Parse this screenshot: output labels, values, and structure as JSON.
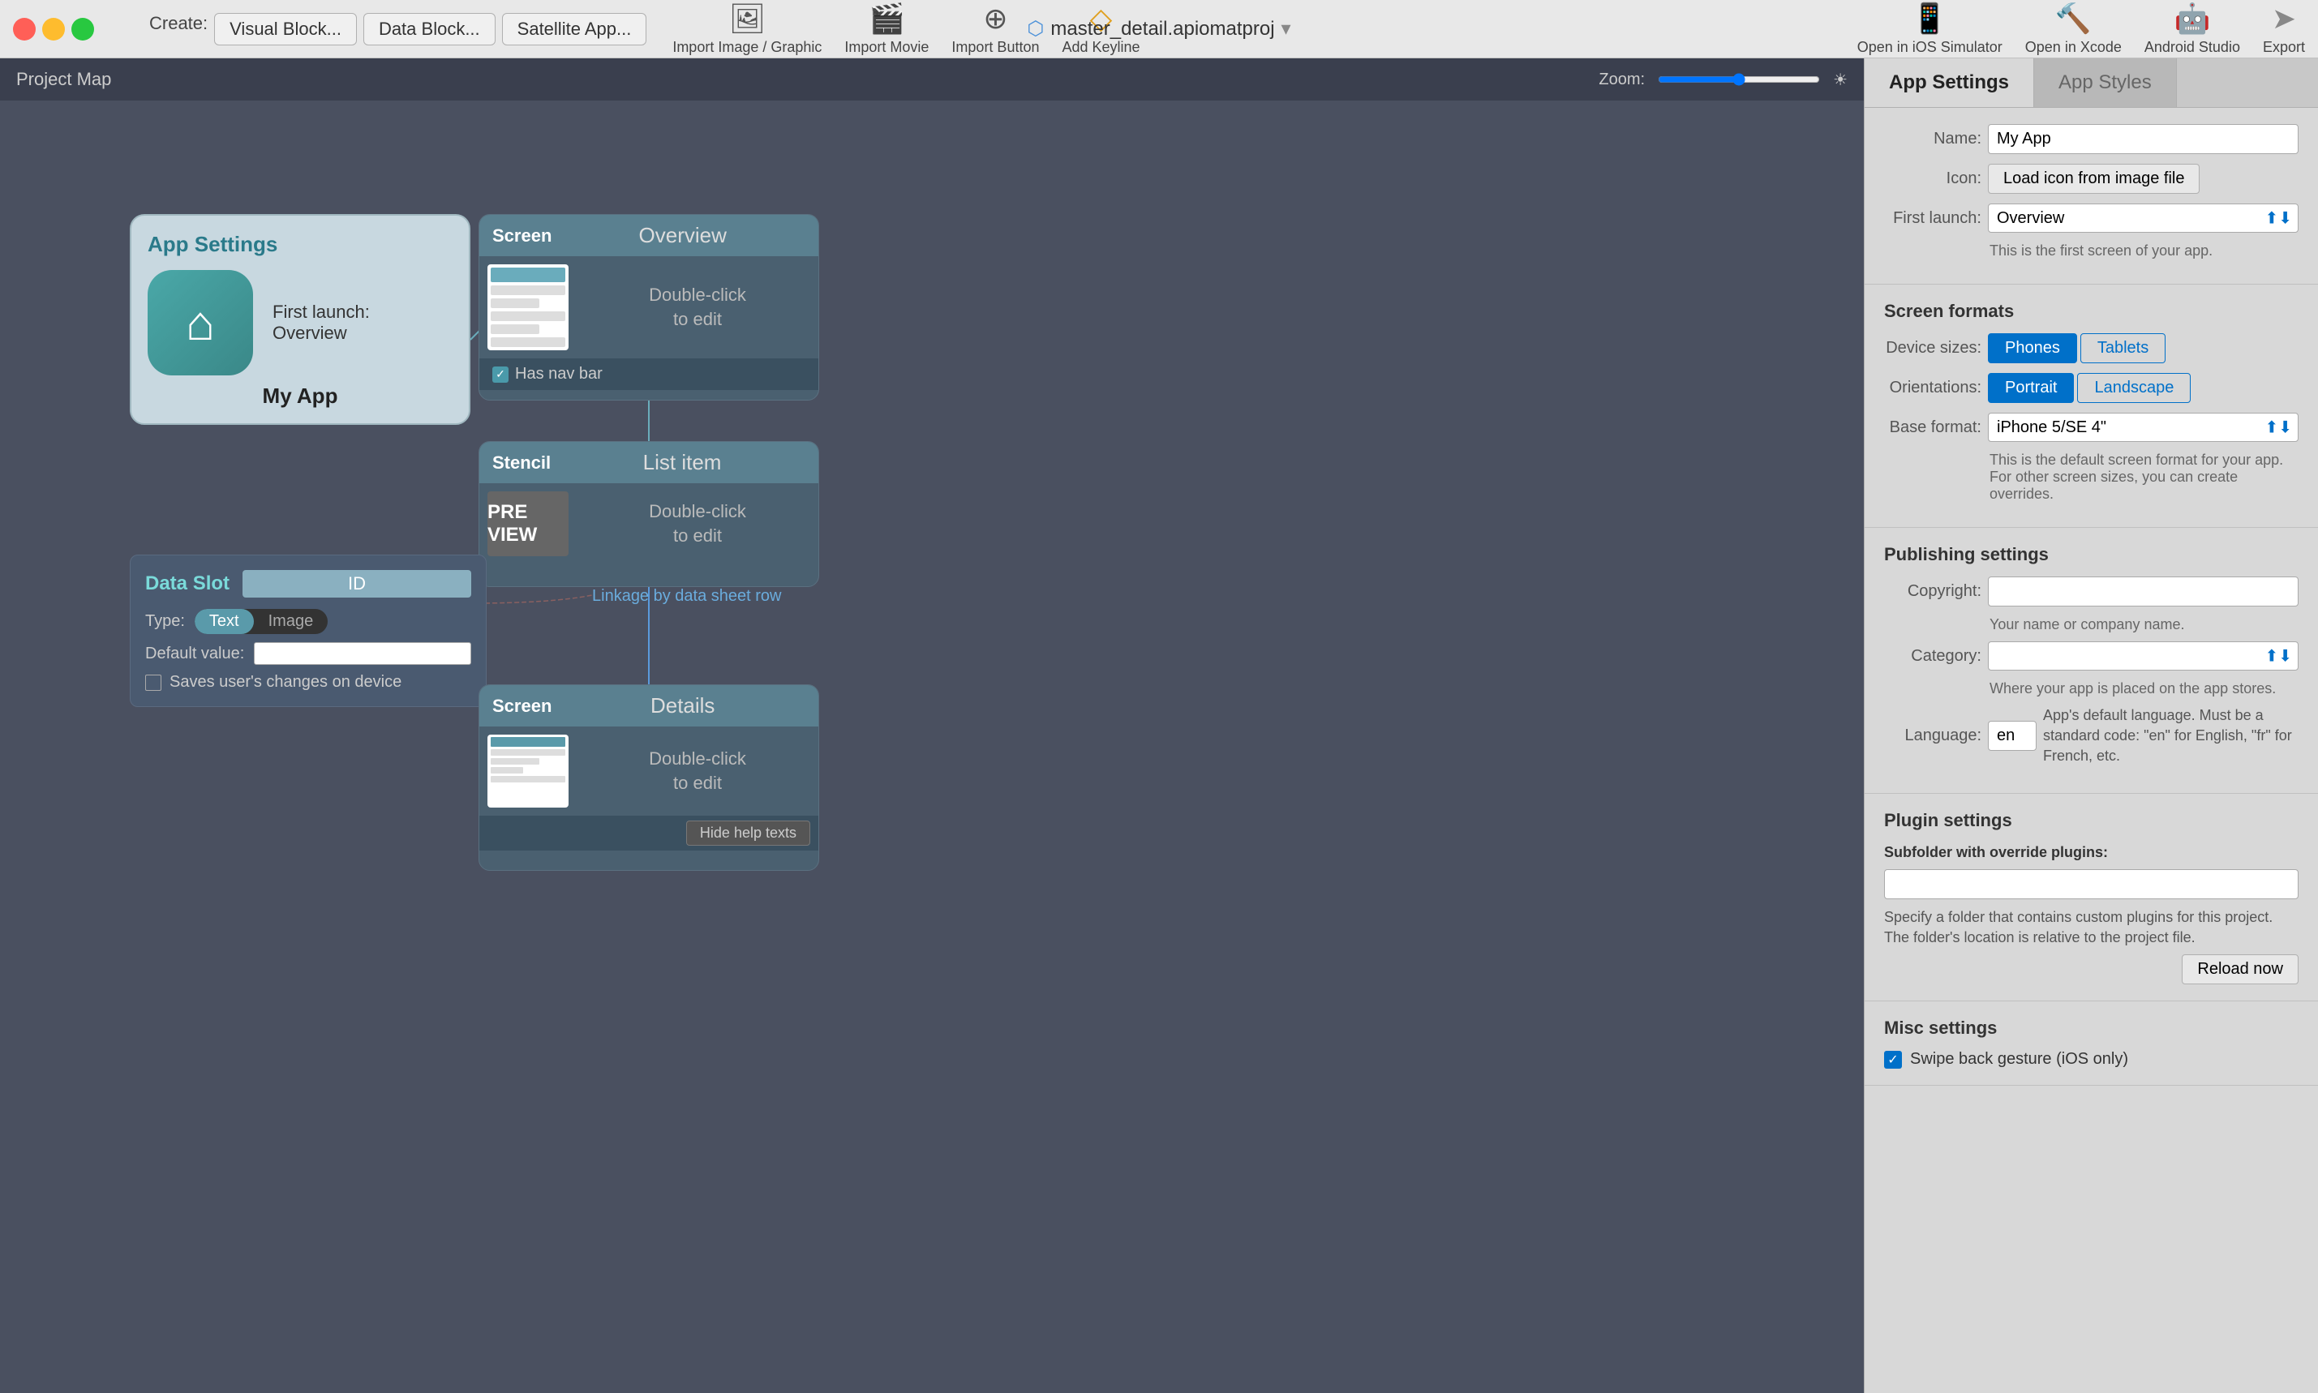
{
  "window": {
    "title": "master_detail.apiomatproj",
    "traffic_lights": [
      "red",
      "yellow",
      "green"
    ]
  },
  "toolbar": {
    "create_label": "Create:",
    "visual_block_btn": "Visual Block...",
    "data_block_btn": "Data Block...",
    "satellite_app_btn": "Satellite App...",
    "import_image_label": "Import Image / Graphic",
    "import_movie_label": "Import Movie",
    "import_button_label": "Import Button",
    "add_keyline_label": "Add Keyline",
    "open_ios_simulator_label": "Open in iOS Simulator",
    "open_xcode_label": "Open in Xcode",
    "android_studio_label": "Android Studio",
    "export_label": "Export"
  },
  "canvas": {
    "title": "Project Map",
    "zoom_label": "Zoom:"
  },
  "nodes": {
    "app_settings": {
      "title": "App Settings",
      "first_launch": "First launch:",
      "first_launch_value": "Overview",
      "app_name": "My App"
    },
    "screen_overview": {
      "type": "Screen",
      "name": "Overview",
      "double_click": "Double-click",
      "to_edit": "to edit",
      "has_nav_bar": "Has nav bar"
    },
    "stencil": {
      "type": "Stencil",
      "name": "List item",
      "double_click": "Double-click",
      "to_edit": "to edit",
      "preview_text": "PRE VIEW"
    },
    "data_slot": {
      "title": "Data Slot",
      "id": "ID",
      "type_label": "Type:",
      "type_text": "Text",
      "type_image": "Image",
      "default_value_label": "Default value:",
      "saves_label": "Saves user's changes on device"
    },
    "screen_details": {
      "type": "Screen",
      "name": "Details",
      "double_click": "Double-click",
      "to_edit": "to edit",
      "hide_help": "Hide help texts"
    },
    "linkage_label": "Linkage by data sheet row"
  },
  "right_panel": {
    "tab_app_settings": "App Settings",
    "tab_app_styles": "App Styles",
    "name_label": "Name:",
    "name_value": "My App",
    "icon_label": "Icon:",
    "icon_btn": "Load icon from image file",
    "first_launch_label": "First launch:",
    "first_launch_value": "Overview",
    "first_launch_hint": "This is the first screen of your app.",
    "screen_formats_title": "Screen formats",
    "device_sizes_label": "Device sizes:",
    "phones_btn": "Phones",
    "tablets_btn": "Tablets",
    "orientations_label": "Orientations:",
    "portrait_btn": "Portrait",
    "landscape_btn": "Landscape",
    "base_format_label": "Base format:",
    "base_format_value": "iPhone 5/SE  4\"",
    "base_format_hint": "This is the default screen format for your app. For other screen sizes, you can create overrides.",
    "publishing_title": "Publishing settings",
    "copyright_label": "Copyright:",
    "copyright_hint": "Your name or company name.",
    "category_label": "Category:",
    "category_hint": "Where your app is placed on the app stores.",
    "language_label": "Language:",
    "language_value": "en",
    "language_hint": "App's default language. Must be a standard code: \"en\" for English, \"fr\" for French, etc.",
    "plugin_title": "Plugin settings",
    "subfolder_label": "Subfolder with override plugins:",
    "plugin_hint": "Specify a folder that contains custom plugins for this project. The folder's location is relative to the project file.",
    "reload_btn": "Reload now",
    "misc_title": "Misc settings",
    "swipe_back_label": "Swipe back gesture (iOS only)"
  }
}
